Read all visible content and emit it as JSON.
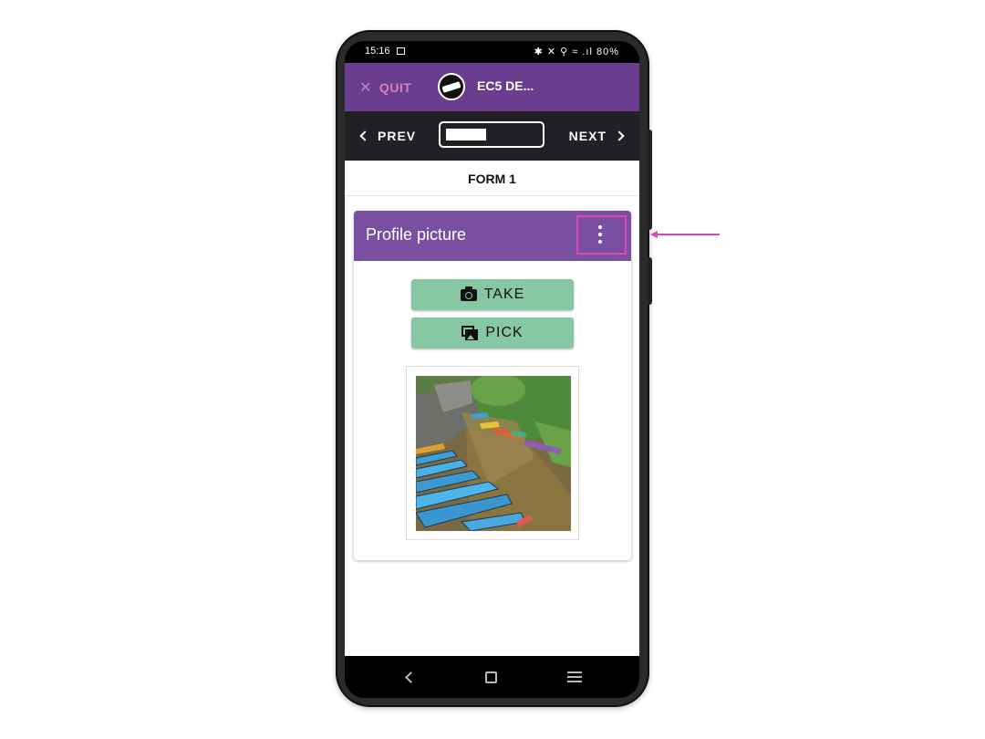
{
  "status_bar": {
    "time": "15:16",
    "right_icons": "✱ ✕ ⚲ ≈ .ıl 80%",
    "battery": "80%"
  },
  "app_bar": {
    "quit_label": "QUIT",
    "project_name": "EC5 DE..."
  },
  "nav": {
    "prev_label": "PREV",
    "next_label": "NEXT"
  },
  "form": {
    "title": "FORM 1"
  },
  "question": {
    "title": "Profile picture",
    "take_label": "TAKE",
    "pick_label": "PICK"
  },
  "colors": {
    "appbar": "#6b3d8f",
    "card_header": "#7a4ea0",
    "button": "#88c7a4",
    "highlight": "#d64ab5"
  }
}
